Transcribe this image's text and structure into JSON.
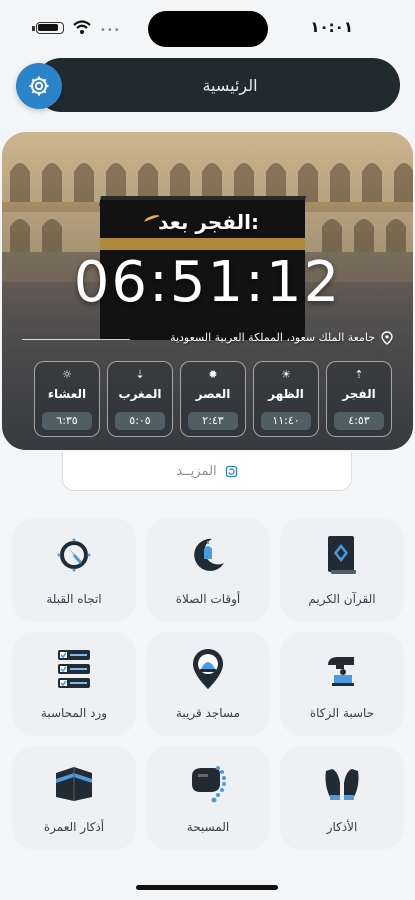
{
  "status_bar": {
    "time": "١٠:٠١",
    "signal": "•••"
  },
  "header": {
    "title": "الرئيسية",
    "settings_icon": "gear-icon"
  },
  "hero": {
    "next_label": "الفجر بعد:",
    "countdown": "06:51:12",
    "location": "جامعة الملك سعود، المملكة العربية السعودية"
  },
  "prayers": [
    {
      "name": "الفجر",
      "time": "٤:٥٣",
      "icon": "sunrise-icon"
    },
    {
      "name": "الظهر",
      "time": "١١:٤٠",
      "icon": "sun-icon"
    },
    {
      "name": "العصر",
      "time": "٢:٤٣",
      "icon": "sun-small-icon"
    },
    {
      "name": "المغرب",
      "time": "٥:٠٥",
      "icon": "sunset-icon"
    },
    {
      "name": "العشاء",
      "time": "٦:٣٥",
      "icon": "moon-sun-icon"
    }
  ],
  "more": {
    "label": "المزيــد"
  },
  "grid": [
    {
      "label": "القرآن الكريم"
    },
    {
      "label": "أوقات الصلاة"
    },
    {
      "label": "اتجاه القبلة"
    },
    {
      "label": "حاسبة الزكاة"
    },
    {
      "label": "مساجد قريبة"
    },
    {
      "label": "ورد المحاسبة"
    },
    {
      "label": "الأذكار"
    },
    {
      "label": "المسبحة"
    },
    {
      "label": "أذكار العمرة"
    }
  ],
  "colors": {
    "accent": "#2b83c9",
    "header_bg": "#1f2b2d",
    "tile_bg": "#eef0f3",
    "icon_dark": "#222a33"
  }
}
